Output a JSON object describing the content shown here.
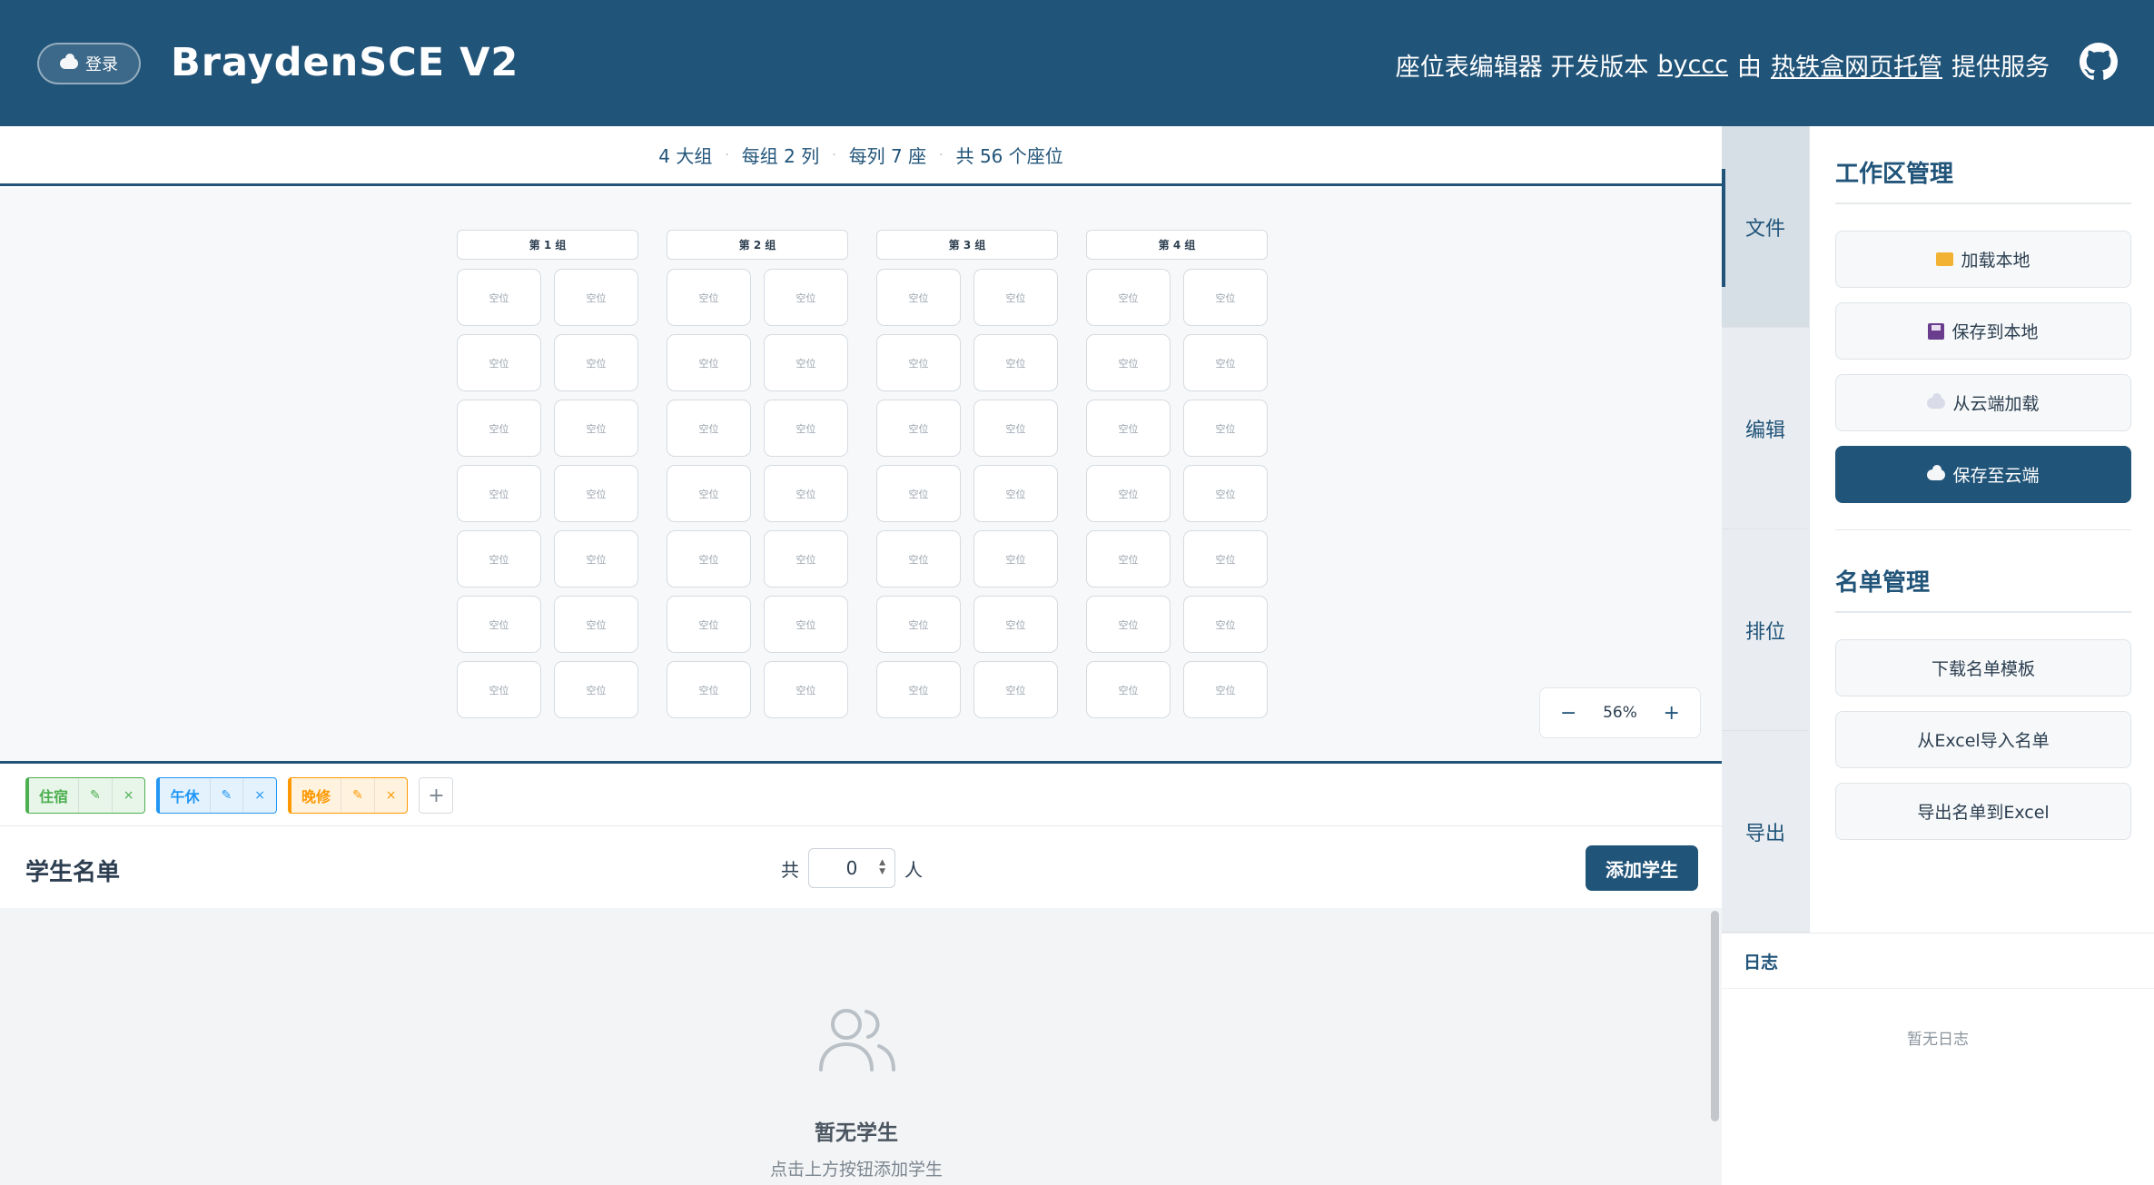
{
  "header": {
    "login_label": "登录",
    "app_title": "BraydenSCE V2",
    "subtitle_text": "座位表编辑器 开发版本",
    "author_link": "byccc",
    "by_text": "由",
    "host_link": "热铁盒网页托管",
    "service_text": "提供服务",
    "github_icon": "github-icon"
  },
  "summary": {
    "groups": "4 大组",
    "cols": "每组 2 列",
    "seats_per_col": "每列 7 座",
    "total": "共 56 个座位"
  },
  "seating": {
    "groups": [
      {
        "label": "第 1 组"
      },
      {
        "label": "第 2 组"
      },
      {
        "label": "第 3 组"
      },
      {
        "label": "第 4 组"
      }
    ],
    "rows": 7,
    "cols": 2,
    "empty_label": "空位"
  },
  "zoom": {
    "minus": "−",
    "value": "56%",
    "plus": "+"
  },
  "tags": [
    {
      "label": "住宿",
      "color": "#4caf50",
      "bg": "#e8f5e9",
      "edit": "✎",
      "remove": "×"
    },
    {
      "label": "午休",
      "color": "#2196f3",
      "bg": "#e3f2fd",
      "edit": "✎",
      "remove": "×"
    },
    {
      "label": "晚修",
      "color": "#ff9800",
      "bg": "#fff3e0",
      "edit": "✎",
      "remove": "×"
    }
  ],
  "tag_add": "+",
  "student_list": {
    "title": "学生名单",
    "count_prefix": "共",
    "count_value": "0",
    "count_suffix": "人",
    "add_button": "添加学生",
    "empty_title": "暂无学生",
    "empty_sub": "点击上方按钮添加学生"
  },
  "side_tabs": [
    "文件",
    "编辑",
    "排位",
    "导出"
  ],
  "workspace": {
    "title": "工作区管理",
    "load_local": "加载本地",
    "save_local": "保存到本地",
    "load_cloud": "从云端加载",
    "save_cloud": "保存至云端"
  },
  "roster": {
    "title": "名单管理",
    "download_template": "下载名单模板",
    "import_excel": "从Excel导入名单",
    "export_excel": "导出名单到Excel"
  },
  "log": {
    "title": "日志",
    "empty": "暂无日志"
  },
  "colors": {
    "primary": "#215479",
    "canvas_bg": "#f7f8fa"
  }
}
